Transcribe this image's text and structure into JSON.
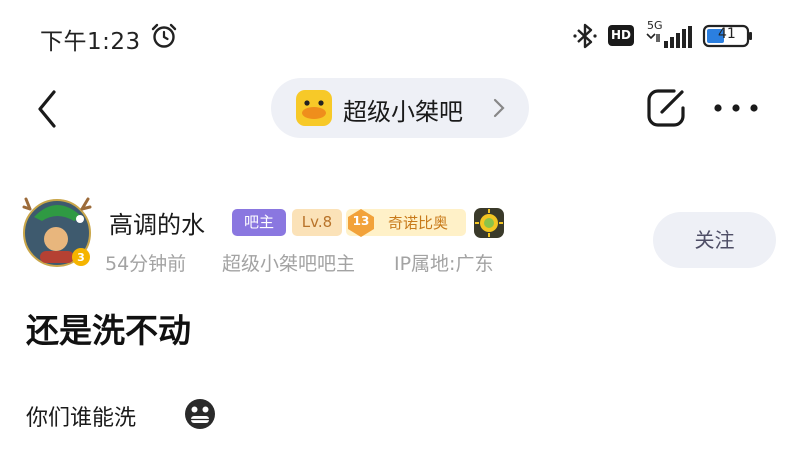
{
  "status_bar": {
    "time": "下午1:23",
    "hd_label": "HD",
    "network_label": "5G",
    "battery_level": "41",
    "icons": [
      "alarm-icon",
      "bluetooth-icon",
      "signal-icon",
      "battery-icon"
    ]
  },
  "nav": {
    "forum_name": "超级小桀吧",
    "icons": [
      "back-icon",
      "duck-icon",
      "chevron-right-icon",
      "edit-icon",
      "more-icon"
    ]
  },
  "author": {
    "name": "高调的水",
    "owner_badge": "吧主",
    "level_badge": "Lv.8",
    "title_badge_number": "13",
    "title_badge_text": "奇诺比奥",
    "avatar_badge_number": "3",
    "post_time": "54分钟前",
    "role": "超级小桀吧吧主",
    "ip_location": "IP属地:广东",
    "follow_label": "关注"
  },
  "post": {
    "title": "还是洗不动",
    "body": "你们谁能洗"
  },
  "colors": {
    "owner_badge": "#8a77e0",
    "level_badge_bg": "#fbe2b8",
    "title_badge_bg": "#fff1c8",
    "pill_bg": "#eef0f6",
    "meta_text": "#a3a3a3"
  }
}
